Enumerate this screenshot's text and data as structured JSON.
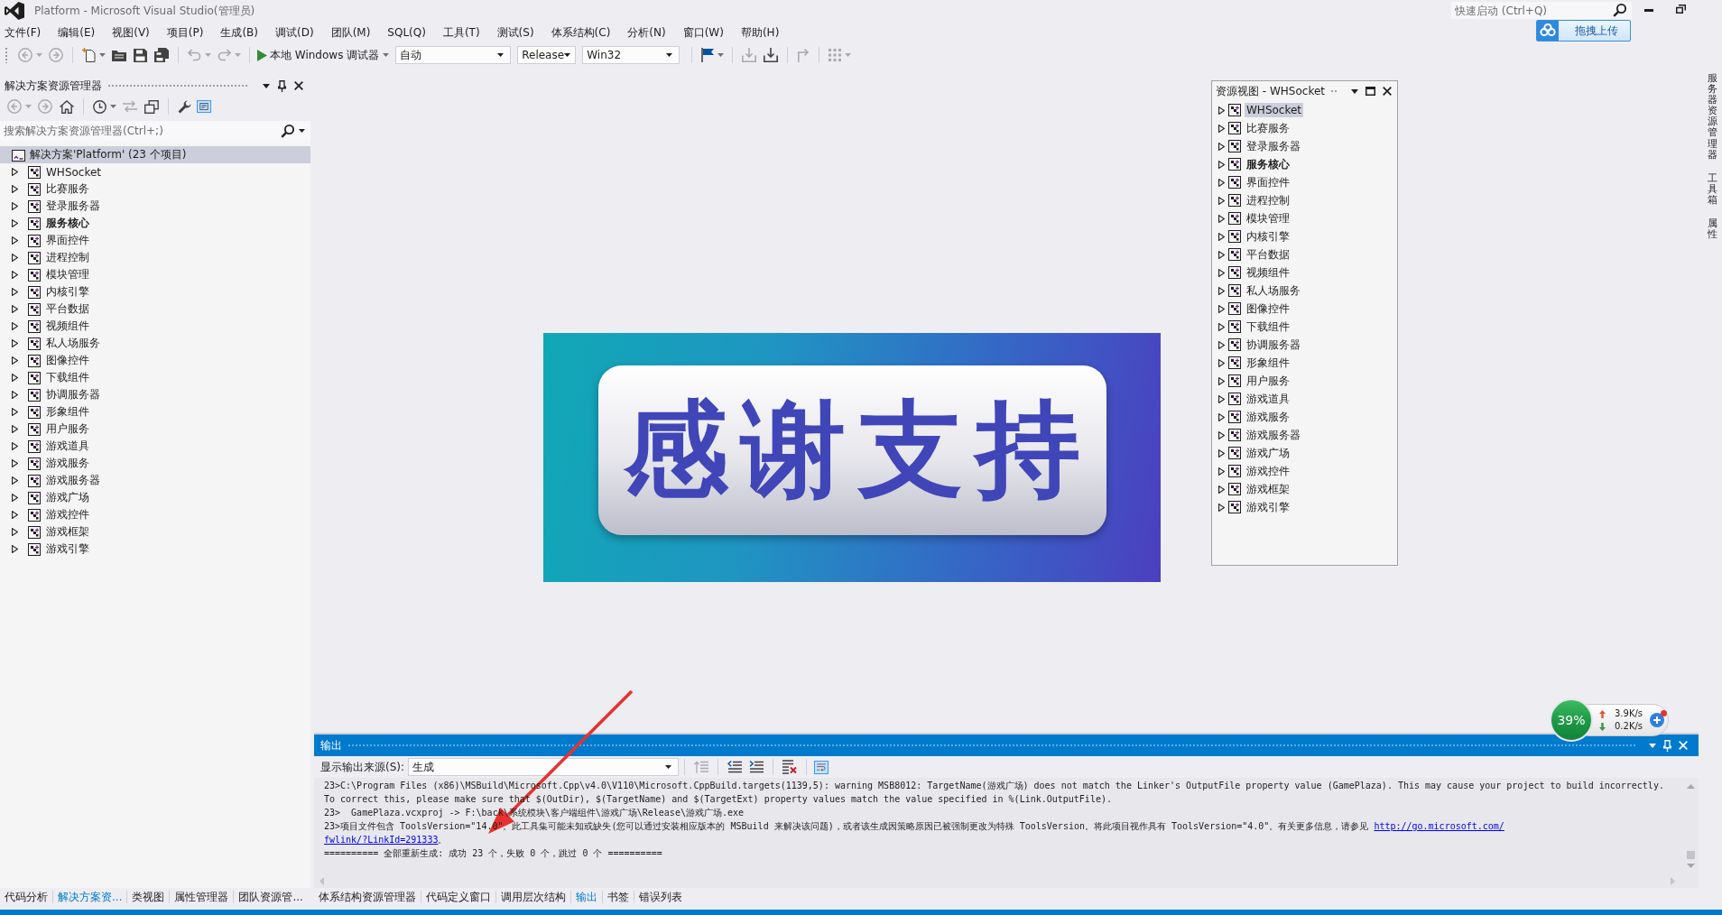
{
  "window": {
    "title": "Platform - Microsoft Visual Studio(管理员)",
    "quick_launch": {
      "placeholder": "快速启动 (Ctrl+Q)"
    }
  },
  "upload_button": {
    "label": "拖拽上传"
  },
  "menu": [
    "文件(F)",
    "编辑(E)",
    "视图(V)",
    "项目(P)",
    "生成(B)",
    "调试(D)",
    "团队(M)",
    "SQL(Q)",
    "工具(T)",
    "测试(S)",
    "体系结构(C)",
    "分析(N)",
    "窗口(W)",
    "帮助(H)"
  ],
  "toolbar": {
    "groups": [
      [
        {
          "kind": "back",
          "disabled": true
        },
        {
          "kind": "forward",
          "disabled": true
        }
      ],
      [
        {
          "kind": "new",
          "disabled": false
        },
        {
          "kind": "open",
          "disabled": false
        },
        {
          "kind": "save",
          "disabled": false
        },
        {
          "kind": "save_all",
          "disabled": false
        }
      ],
      [
        {
          "kind": "undo",
          "disabled": true
        },
        {
          "kind": "redo",
          "disabled": true
        }
      ],
      [
        {
          "kind": "debug",
          "label": "本地 Windows 调试器",
          "disabled": false
        },
        {
          "kind": "combo",
          "value": "自动",
          "disabled": false
        },
        {
          "kind": "combo",
          "value": "Release",
          "disabled": false
        },
        {
          "kind": "combo",
          "value": "Win32",
          "disabled": false
        }
      ],
      [
        {
          "kind": "find",
          "disabled": false
        }
      ],
      [
        {
          "kind": "build",
          "disabled": true
        },
        {
          "kind": "build",
          "disabled": false
        }
      ],
      [
        {
          "kind": "corner",
          "disabled": true
        }
      ],
      [
        {
          "kind": "grid",
          "disabled": true
        }
      ]
    ]
  },
  "solution_explorer": {
    "title": "解决方案资源管理器",
    "toolbar": {
      "groups": [
        [
          {
            "kind": "back",
            "disabled": true,
            "on": false
          },
          {
            "kind": "forward",
            "disabled": true,
            "on": false
          },
          {
            "kind": "home",
            "disabled": false,
            "on": false
          }
        ],
        [
          {
            "kind": "history",
            "disabled": false,
            "on": false
          },
          {
            "kind": "sync",
            "disabled": true,
            "on": false
          },
          {
            "kind": "collapse",
            "disabled": false,
            "on": false
          }
        ],
        [
          {
            "kind": "properties",
            "disabled": false,
            "on": false
          },
          {
            "kind": "preview",
            "disabled": false,
            "on": true
          }
        ]
      ]
    },
    "search": {
      "placeholder": "搜索解决方案资源管理器(Ctrl+;)"
    },
    "root": {
      "label": "解决方案'Platform' (23 个项目)",
      "selected": true,
      "children": [
        {
          "label": "WHSocket",
          "expanded": false,
          "selected": false,
          "startup": false
        },
        {
          "label": "比赛服务",
          "expanded": false,
          "selected": false,
          "startup": false
        },
        {
          "label": "登录服务器",
          "expanded": false,
          "selected": false,
          "startup": false
        },
        {
          "label": "服务核心",
          "expanded": false,
          "selected": false,
          "startup": true
        },
        {
          "label": "界面控件",
          "expanded": false,
          "selected": false,
          "startup": false
        },
        {
          "label": "进程控制",
          "expanded": false,
          "selected": false,
          "startup": false
        },
        {
          "label": "模块管理",
          "expanded": false,
          "selected": false,
          "startup": false
        },
        {
          "label": "内核引擎",
          "expanded": false,
          "selected": false,
          "startup": false
        },
        {
          "label": "平台数据",
          "expanded": false,
          "selected": false,
          "startup": false
        },
        {
          "label": "视频组件",
          "expanded": false,
          "selected": false,
          "startup": false
        },
        {
          "label": "私人场服务",
          "expanded": false,
          "selected": false,
          "startup": false
        },
        {
          "label": "图像控件",
          "expanded": false,
          "selected": false,
          "startup": false
        },
        {
          "label": "下载组件",
          "expanded": false,
          "selected": false,
          "startup": false
        },
        {
          "label": "协调服务器",
          "expanded": false,
          "selected": false,
          "startup": false
        },
        {
          "label": "形象组件",
          "expanded": false,
          "selected": false,
          "startup": false
        },
        {
          "label": "用户服务",
          "expanded": false,
          "selected": false,
          "startup": false
        },
        {
          "label": "游戏道具",
          "expanded": false,
          "selected": false,
          "startup": false
        },
        {
          "label": "游戏服务",
          "expanded": false,
          "selected": false,
          "startup": false
        },
        {
          "label": "游戏服务器",
          "expanded": false,
          "selected": false,
          "startup": false
        },
        {
          "label": "游戏广场",
          "expanded": false,
          "selected": false,
          "startup": false
        },
        {
          "label": "游戏控件",
          "expanded": false,
          "selected": false,
          "startup": false
        },
        {
          "label": "游戏框架",
          "expanded": false,
          "selected": false,
          "startup": false
        },
        {
          "label": "游戏引擎",
          "expanded": false,
          "selected": false,
          "startup": false
        }
      ]
    },
    "tabs": [
      {
        "label": "代码分析",
        "selected": false
      },
      {
        "label": "解决方案资...",
        "selected": true
      },
      {
        "label": "类视图",
        "selected": false
      },
      {
        "label": "属性管理器",
        "selected": false
      },
      {
        "label": "团队资源管...",
        "selected": false
      }
    ]
  },
  "resource_view": {
    "title": "资源视图 - WHSocket",
    "items": [
      {
        "label": "WHSocket",
        "expanded": false,
        "selected": true,
        "startup": false
      },
      {
        "label": "比赛服务",
        "expanded": false,
        "selected": false,
        "startup": false
      },
      {
        "label": "登录服务器",
        "expanded": false,
        "selected": false,
        "startup": false
      },
      {
        "label": "服务核心",
        "expanded": false,
        "selected": false,
        "startup": true
      },
      {
        "label": "界面控件",
        "expanded": false,
        "selected": false,
        "startup": false
      },
      {
        "label": "进程控制",
        "expanded": false,
        "selected": false,
        "startup": false
      },
      {
        "label": "模块管理",
        "expanded": false,
        "selected": false,
        "startup": false
      },
      {
        "label": "内核引擎",
        "expanded": false,
        "selected": false,
        "startup": false
      },
      {
        "label": "平台数据",
        "expanded": false,
        "selected": false,
        "startup": false
      },
      {
        "label": "视频组件",
        "expanded": false,
        "selected": false,
        "startup": false
      },
      {
        "label": "私人场服务",
        "expanded": false,
        "selected": false,
        "startup": false
      },
      {
        "label": "图像控件",
        "expanded": false,
        "selected": false,
        "startup": false
      },
      {
        "label": "下载组件",
        "expanded": false,
        "selected": false,
        "startup": false
      },
      {
        "label": "协调服务器",
        "expanded": false,
        "selected": false,
        "startup": false
      },
      {
        "label": "形象组件",
        "expanded": false,
        "selected": false,
        "startup": false
      },
      {
        "label": "用户服务",
        "expanded": false,
        "selected": false,
        "startup": false
      },
      {
        "label": "游戏道具",
        "expanded": false,
        "selected": false,
        "startup": false
      },
      {
        "label": "游戏服务",
        "expanded": false,
        "selected": false,
        "startup": false
      },
      {
        "label": "游戏服务器",
        "expanded": false,
        "selected": false,
        "startup": false
      },
      {
        "label": "游戏广场",
        "expanded": false,
        "selected": false,
        "startup": false
      },
      {
        "label": "游戏控件",
        "expanded": false,
        "selected": false,
        "startup": false
      },
      {
        "label": "游戏框架",
        "expanded": false,
        "selected": false,
        "startup": false
      },
      {
        "label": "游戏引擎",
        "expanded": false,
        "selected": false,
        "startup": false
      }
    ]
  },
  "banner": {
    "text": "感谢支持"
  },
  "side_tabs": [
    "服务器资源管理器",
    "工具箱",
    "属性"
  ],
  "output": {
    "title": "输出",
    "source": {
      "label": "显示输出来源(S):",
      "value": "生成"
    },
    "toolbar": {
      "groups": [
        [
          {
            "kind": "previous",
            "disabled": true,
            "on": false
          }
        ],
        [
          {
            "kind": "outdent",
            "disabled": false,
            "on": false
          },
          {
            "kind": "indent",
            "disabled": false,
            "on": false
          }
        ],
        [
          {
            "kind": "clear",
            "disabled": false,
            "on": false
          }
        ],
        [
          {
            "kind": "wrap",
            "disabled": false,
            "on": true
          }
        ]
      ]
    },
    "lines": [
      [
        {
          "kind": "text",
          "text": "23>C:\\Program Files (x86)\\MSBuild\\Microsoft.Cpp\\v4.0\\V110\\Microsoft.CppBuild.targets(1139,5): warning MSB8012: TargetName(游戏广场) does not match the Linker's OutputFile property value (GamePlaza). This may cause your project to build incorrectly."
        }
      ],
      [
        {
          "kind": "text",
          "text": "To correct this, please make sure that $(OutDir), $(TargetName) and $(TargetExt) property values match the value specified in %(Link.OutputFile)."
        }
      ],
      [
        {
          "kind": "text",
          "text": "23>  GamePlaza.vcxproj -> F:\\back\\系统模块\\客户端组件\\游戏广场\\Release\\游戏广场.exe"
        }
      ],
      [
        {
          "kind": "text",
          "text": "23>项目文件包含 ToolsVersion=\"14.0\"。此工具集可能未知或缺失(您可以通过安装相应版本的 MSBuild 来解决该问题)，或者该生成因策略原因已被强制更改为特殊 ToolsVersion。将此项目视作具有 ToolsVersion=\"4.0\"。有关更多信息，请参见 "
        },
        {
          "kind": "link",
          "text": "http://go.microsoft.com/"
        }
      ],
      [
        {
          "kind": "link",
          "text": "fwlink/?LinkId=291333"
        },
        {
          "kind": "text",
          "text": "。"
        }
      ],
      [
        {
          "kind": "text",
          "text": "========== 全部重新生成: 成功 23 个，失败 0 个，跳过 0 个 =========="
        }
      ]
    ],
    "tabs": [
      {
        "label": "体系结构资源管理器",
        "selected": false
      },
      {
        "label": "代码定义窗口",
        "selected": false
      },
      {
        "label": "调用层次结构",
        "selected": false
      },
      {
        "label": "输出",
        "selected": true
      },
      {
        "label": "书签",
        "selected": false
      },
      {
        "label": "错误列表",
        "selected": false
      }
    ]
  },
  "net_monitor": {
    "usage": "39%",
    "upload": "3.9K/s",
    "download": "0.2K/s"
  }
}
